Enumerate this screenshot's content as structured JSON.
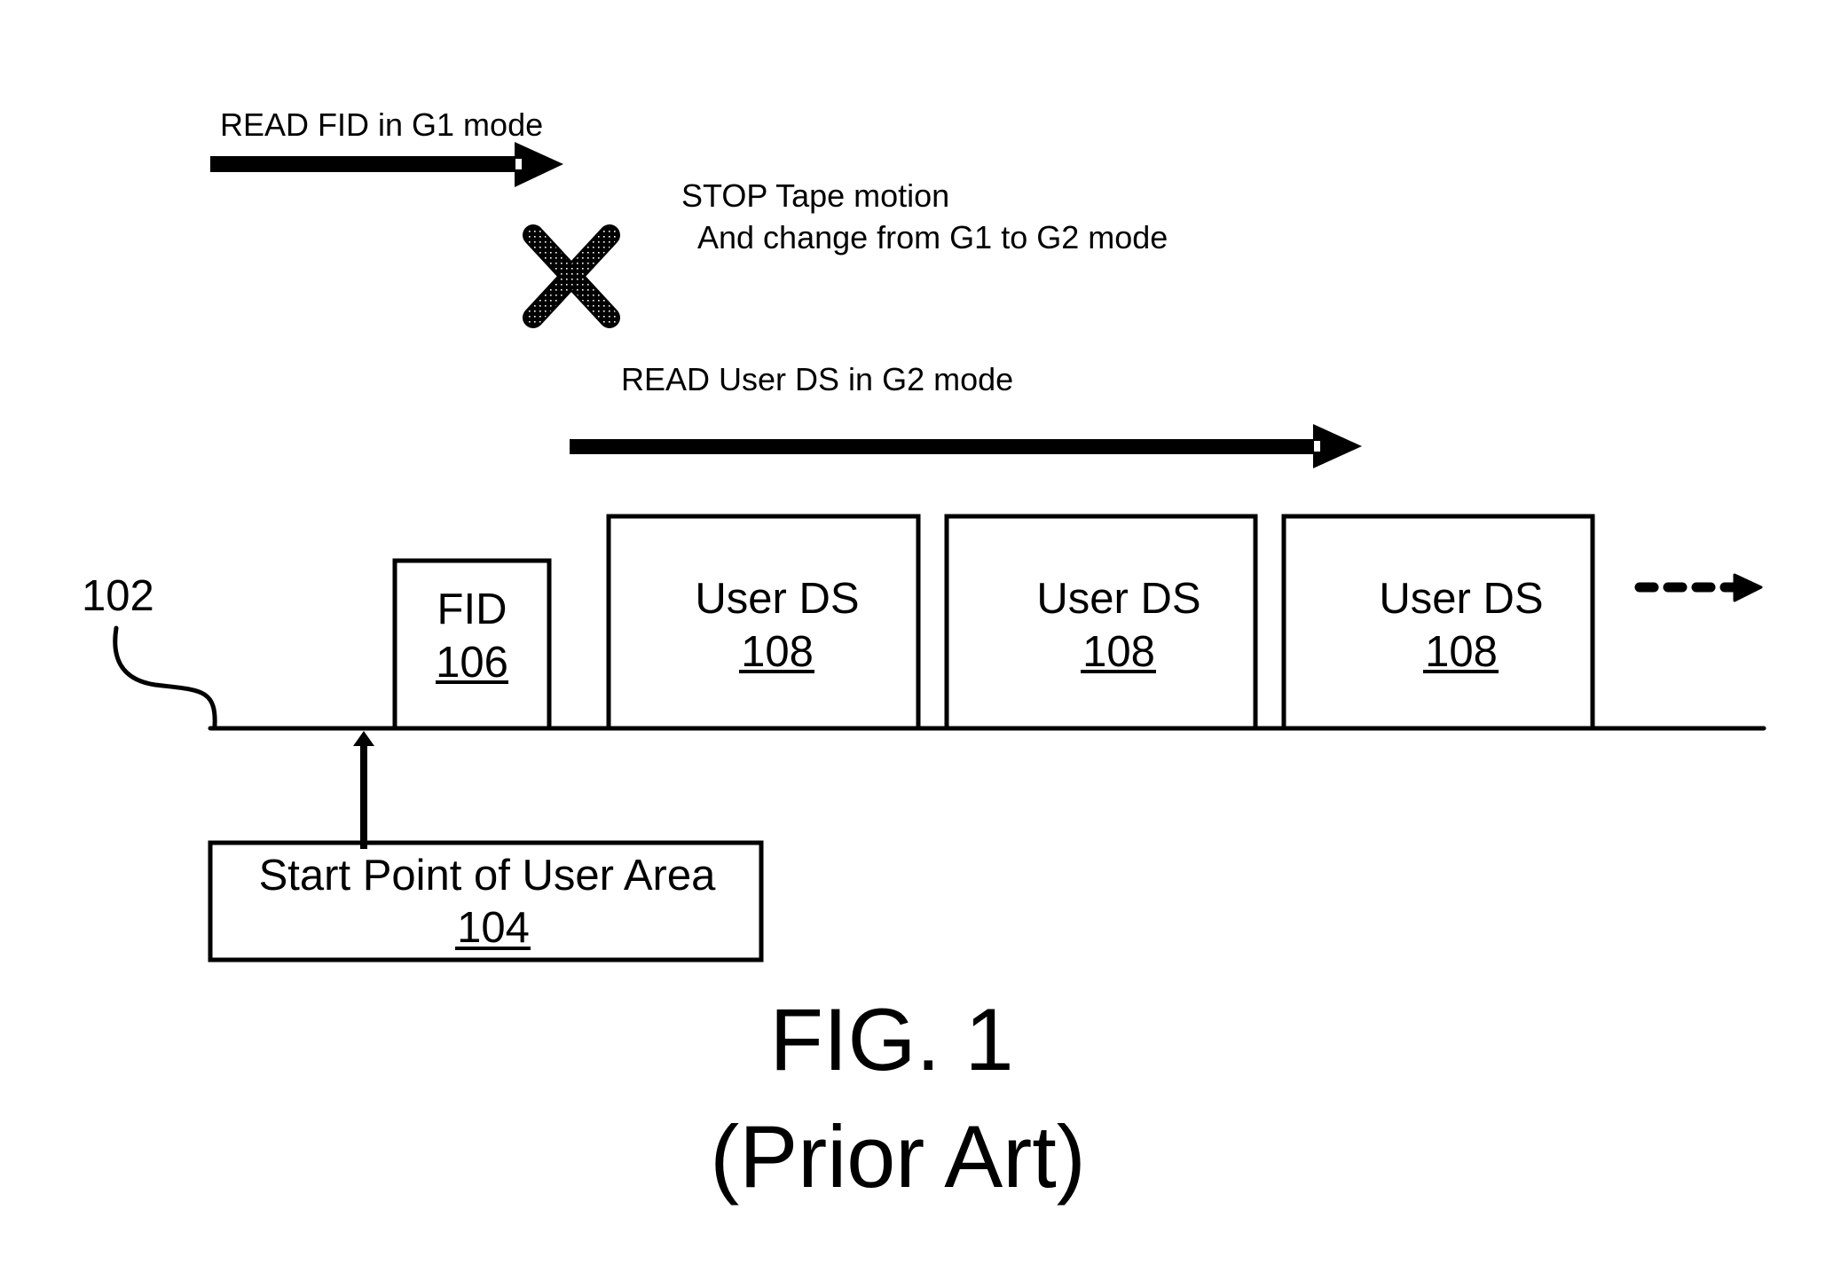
{
  "figure": {
    "title": "FIG. 1",
    "subtitle": "(Prior Art)"
  },
  "annotations": {
    "read_fid": "READ FID in G1 mode",
    "stop_line1": "STOP Tape motion",
    "stop_line2": "And change from G1 to G2 mode",
    "read_user_ds": "READ User DS in G2 mode"
  },
  "tape": {
    "ref": "102"
  },
  "blocks": [
    {
      "label": "FID",
      "ref": "106"
    },
    {
      "label": "User DS",
      "ref": "108"
    },
    {
      "label": "User DS",
      "ref": "108"
    },
    {
      "label": "User DS",
      "ref": "108"
    }
  ],
  "start_point": {
    "label": "Start Point of User Area",
    "ref": "104"
  },
  "icons": {
    "stop": "x-mark-icon",
    "continuation": "dashed-arrow-right-icon"
  },
  "colors": {
    "ink": "#000000",
    "paper": "#ffffff"
  }
}
